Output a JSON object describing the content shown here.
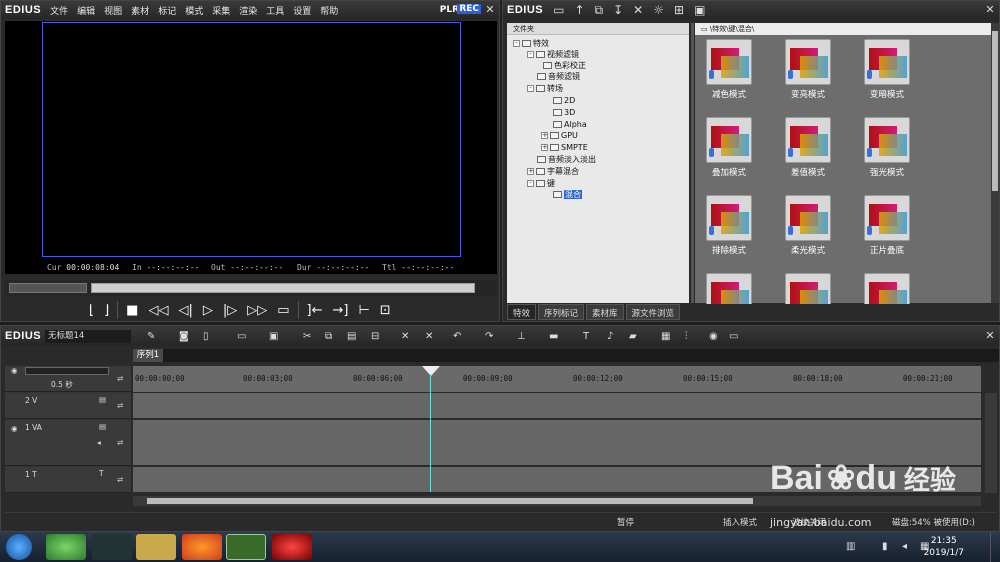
{
  "player": {
    "logo": "EDIUS",
    "menu": [
      "文件",
      "编辑",
      "视图",
      "素材",
      "标记",
      "模式",
      "采集",
      "渲染",
      "工具",
      "设置",
      "帮助"
    ],
    "plr": "PLR",
    "rec": "REC",
    "timecodes": {
      "cur_label": "Cur",
      "cur": "00:00:08:04",
      "in_label": "In",
      "in": "--:--:--:--",
      "out_label": "Out",
      "out": "--:--:--:--",
      "dur_label": "Dur",
      "dur": "--:--:--:--",
      "ttl_label": "Ttl",
      "ttl": "--:--:--:--"
    }
  },
  "bin": {
    "logo": "EDIUS",
    "tree_header": "文件夹",
    "path": "\\特效\\键\\混合\\",
    "tree": [
      {
        "label": "特效",
        "box": "-",
        "depth": 0
      },
      {
        "label": "视频滤镜",
        "box": "-",
        "depth": 1
      },
      {
        "label": "色彩校正",
        "box": "",
        "depth": 2
      },
      {
        "label": "音频滤镜",
        "box": "",
        "depth": 1
      },
      {
        "label": "转场",
        "box": "-",
        "depth": 1
      },
      {
        "label": "2D",
        "box": "",
        "depth": 2
      },
      {
        "label": "3D",
        "box": "",
        "depth": 2
      },
      {
        "label": "Alpha",
        "box": "",
        "depth": 2
      },
      {
        "label": "GPU",
        "box": "+",
        "depth": 2
      },
      {
        "label": "SMPTE",
        "box": "+",
        "depth": 2
      },
      {
        "label": "音频淡入淡出",
        "box": "",
        "depth": 1
      },
      {
        "label": "字幕混合",
        "box": "+",
        "depth": 1
      },
      {
        "label": "键",
        "box": "-",
        "depth": 1
      },
      {
        "label": "混合",
        "box": "",
        "depth": 2,
        "selected": true
      }
    ],
    "effects": [
      "减色模式",
      "变亮模式",
      "变暗模式",
      "叠加模式",
      "差值模式",
      "强光模式",
      "排除模式",
      "柔光模式",
      "正片叠底",
      "",
      "",
      ""
    ],
    "tabs": [
      "特效",
      "序列标记",
      "素材库",
      "源文件浏览"
    ]
  },
  "timeline": {
    "logo": "EDIUS",
    "project_name": "无标题14",
    "sequence_tab": "序列1",
    "zoom": "0.5 秒",
    "ruler": [
      "00:00:00;00",
      "00:00:03;00",
      "00:00:06;00",
      "00:00:09;00",
      "00:00:12;00",
      "00:00:15;00",
      "00:00:18;00",
      "00:00:21;00"
    ],
    "tracks": [
      {
        "name": "2 V"
      },
      {
        "name": "1 VA"
      },
      {
        "name": "1 T"
      }
    ],
    "status": {
      "pause": "暂停",
      "insert_mode": "插入模式",
      "ripple": "波纹关闭",
      "disk": "磁盘:54% 被使用(D:)"
    }
  },
  "taskbar": {
    "time": "21:35",
    "date": "2019/1/7"
  },
  "watermark": {
    "brand": "Bai",
    "brand2": "du",
    "cn": "经验",
    "url": "jingyan.baidu.com"
  }
}
